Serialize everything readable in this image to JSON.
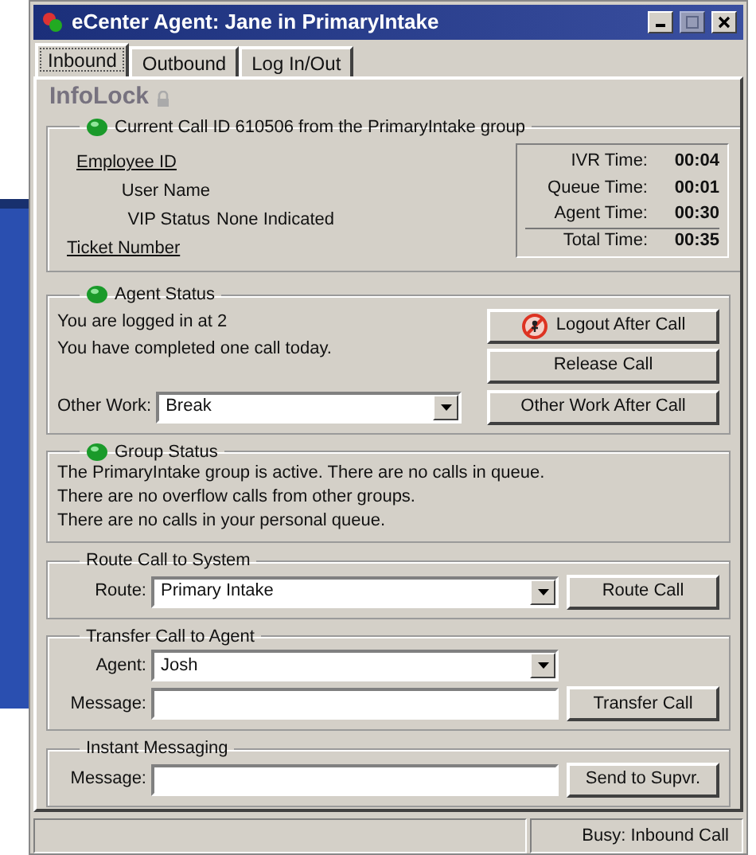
{
  "window": {
    "title": "eCenter Agent: Jane in PrimaryIntake"
  },
  "tabs": [
    {
      "label": "Inbound",
      "selected": true
    },
    {
      "label": "Outbound",
      "selected": false
    },
    {
      "label": "Log In/Out",
      "selected": false
    }
  ],
  "brand": "InfoLock",
  "current_call": {
    "legend": "Current Call ID 610506 from the PrimaryIntake group",
    "fields": [
      {
        "label": "Employee ID",
        "kind": "link"
      },
      {
        "label": "User Name",
        "kind": "text"
      },
      {
        "label": "VIP Status",
        "kind": "text",
        "value": "None Indicated"
      },
      {
        "label": "Ticket Number",
        "kind": "link"
      }
    ],
    "timers": [
      {
        "label": "IVR Time:",
        "value": "00:04"
      },
      {
        "label": "Queue Time:",
        "value": "00:01"
      },
      {
        "label": "Agent Time:",
        "value": "00:30"
      },
      {
        "label": "Total Time:",
        "value": "00:35"
      }
    ]
  },
  "agent_status": {
    "legend": "Agent Status",
    "lines": [
      "You are logged in at 2",
      "You have completed one call today."
    ],
    "other_work": {
      "label": "Other Work:",
      "value": "Break"
    },
    "buttons": [
      {
        "label": "Logout After Call",
        "icon": true
      },
      {
        "label": "Release Call"
      },
      {
        "label": "Other Work After Call"
      }
    ]
  },
  "group_status": {
    "legend": "Group Status",
    "lines": [
      "The PrimaryIntake group is active.  There are no calls in queue.",
      "There are no overflow calls from other groups.",
      "There are no calls in your personal queue."
    ]
  },
  "route": {
    "legend": "Route Call to System",
    "label": "Route:",
    "value": "Primary Intake",
    "button": "Route Call"
  },
  "transfer": {
    "legend": "Transfer Call to Agent",
    "agent_label": "Agent:",
    "agent_value": "Josh",
    "message_label": "Message:",
    "button": "Transfer Call"
  },
  "instant": {
    "legend": "Instant Messaging",
    "message_label": "Message:",
    "button": "Send to Supvr."
  },
  "status_bar": {
    "text": "Busy: Inbound Call"
  }
}
